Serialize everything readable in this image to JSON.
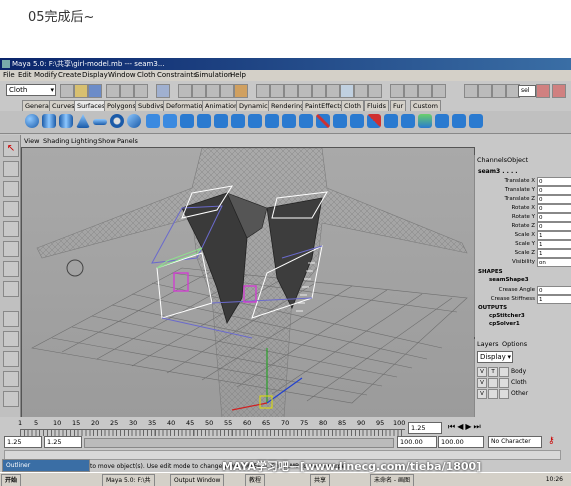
{
  "caption": "05完成后~",
  "window": {
    "title": "Maya 5.0: F:\\共享\\girl-model.mb  ---  seam3..."
  },
  "menus": [
    "File",
    "Edit",
    "Modify",
    "Create",
    "Display",
    "Window",
    "Cloth",
    "Constraints",
    "Simulation",
    "Help"
  ],
  "menu_set": "Cloth",
  "sel_label": "sel",
  "shelf_tabs": [
    "General",
    "Curves",
    "Surfaces",
    "Polygons",
    "Subdivs",
    "Deformation",
    "Animation",
    "Dynamics",
    "Rendering",
    "PaintEffects",
    "Cloth",
    "Fluids",
    "Fur",
    "Custom"
  ],
  "active_shelf_tab": "Surfaces",
  "panel_menus": [
    "View",
    "Shading",
    "Lighting",
    "Show",
    "Panels"
  ],
  "channel_box": {
    "tabs": [
      "Channels",
      "Object"
    ],
    "object": "seam3 . . . .",
    "attributes": [
      {
        "name": "Translate X",
        "value": "0"
      },
      {
        "name": "Translate Y",
        "value": "0"
      },
      {
        "name": "Translate Z",
        "value": "0"
      },
      {
        "name": "Rotate X",
        "value": "0"
      },
      {
        "name": "Rotate Y",
        "value": "0"
      },
      {
        "name": "Rotate Z",
        "value": "0"
      },
      {
        "name": "Scale X",
        "value": "1"
      },
      {
        "name": "Scale Y",
        "value": "1"
      },
      {
        "name": "Scale Z",
        "value": "1"
      },
      {
        "name": "Visibility",
        "value": "on"
      }
    ],
    "shapes_label": "SHAPES",
    "shape": "seamShape3",
    "shape_attrs": [
      {
        "name": "Crease Angle",
        "value": "0"
      },
      {
        "name": "Crease Stiffness",
        "value": "1"
      }
    ],
    "outputs_label": "OUTPUTS",
    "outputs": [
      "cpStitcher3",
      "cpSolver1"
    ]
  },
  "layers": {
    "tabs": [
      "Layers",
      "Options"
    ],
    "display": "Display",
    "items": [
      {
        "v": "V",
        "t": "T",
        "name": "Body"
      },
      {
        "v": "V",
        "t": "",
        "name": "Cloth"
      },
      {
        "v": "V",
        "t": "",
        "name": "Other"
      }
    ]
  },
  "timeline": {
    "ticks": [
      "1",
      "5",
      "10",
      "15",
      "20",
      "25",
      "30",
      "35",
      "40",
      "45",
      "50",
      "55",
      "60",
      "65",
      "70",
      "75",
      "80",
      "85",
      "90",
      "95",
      "100"
    ],
    "current": "1.25"
  },
  "range": {
    "start": "1.25",
    "playback_start": "1.25",
    "playback_end": "100.00",
    "end": "100.00",
    "character": "No Character Set"
  },
  "help": "to move object(s). Use edit mode to change pivot (INSERT). Ctrl+LMB to move perpe",
  "taskbar": {
    "start": "开始",
    "outliner": "Outliner",
    "items": [
      "Maya 5.0: F:\\共",
      "Output Window",
      "教程",
      "共享",
      "未命名 - 画图"
    ],
    "time": "10:26"
  },
  "watermark": "MAYA学习吧—[www.linecg.com/tieba/1800]"
}
